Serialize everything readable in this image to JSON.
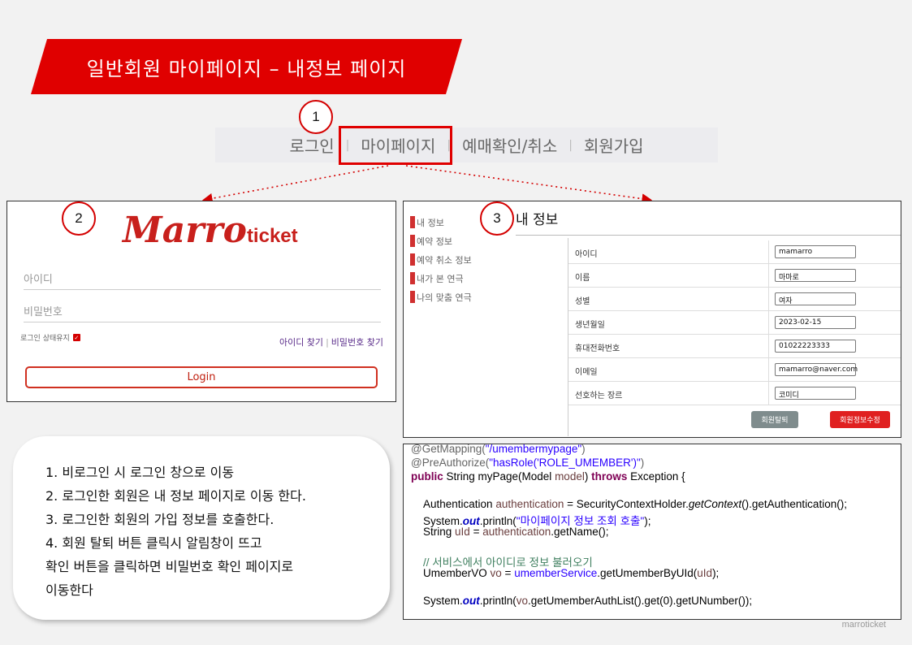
{
  "banner": {
    "title": "일반회원 마이페이지 – 내정보 페이지"
  },
  "steps": [
    "1",
    "2",
    "3"
  ],
  "nav": {
    "items": [
      "로그인",
      "마이페이지",
      "예매확인/취소",
      "회원가입"
    ]
  },
  "login": {
    "logo_main": "Marro",
    "logo_sub": "ticket",
    "id_placeholder": "아이디",
    "pw_placeholder": "비밀번호",
    "remember_label": "로그인 상태유지",
    "find_id": "아이디 찾기",
    "find_pw": "비밀번호 찾기",
    "login_button": "Login"
  },
  "mypage": {
    "title": "내 정보",
    "menu": [
      "내 정보",
      "예약 정보",
      "예약 취소 정보",
      "내가 본 연극",
      "나의 맞춤 연극"
    ],
    "fields": [
      {
        "label": "아이디",
        "value": "mamarro"
      },
      {
        "label": "이름",
        "value": "마마로"
      },
      {
        "label": "성별",
        "value": "여자"
      },
      {
        "label": "생년월일",
        "value": "2023-02-15"
      },
      {
        "label": "휴대전화번호",
        "value": "01022223333"
      },
      {
        "label": "이메일",
        "value": "mamarro@naver.com"
      },
      {
        "label": "선호하는 장르",
        "value": "코미디"
      }
    ],
    "withdraw_button": "회원탈퇴",
    "edit_button": "회원정보수정"
  },
  "notes": [
    "1. 비로그인 시 로그인 창으로 이동",
    "2. 로그인한 회원은 내 정보 페이지로 이동 한다.",
    "3. 로그인한 회원의 가입 정보를 호출한다.",
    "4. 회원 탈퇴 버튼 클릭시 알림창이 뜨고",
    "확인 버튼을 클릭하면 비밀번호 확인 페이지로",
    "이동한다"
  ],
  "code": {
    "l1_ann": "@GetMapping(",
    "l1_str": "\"/umembermypage\"",
    "l1_end": ")",
    "l2_ann": "@PreAuthorize(",
    "l2_str": "\"hasRole('ROLE_UMEMBER')\"",
    "l2_end": ")",
    "l3_kw1": "public",
    "l3_a": " String myPage(Model ",
    "l3_var": "model",
    "l3_b": ") ",
    "l3_kw2": "throws",
    "l3_c": " Exception {",
    "l4_a": "Authentication ",
    "l4_var": "authentication",
    "l4_b": " = SecurityContextHolder.",
    "l4_it": "getContext",
    "l4_c": "().getAuthentication();",
    "l5_a": "System.",
    "l5_fld": "out",
    "l5_b": ".println(",
    "l5_str": "\"마이페이지 정보 조회 호출\"",
    "l5_c": ");",
    "l6_a": "String ",
    "l6_var": "uId",
    "l6_b": " = ",
    "l6_var2": "authentication",
    "l6_c": ".getName();",
    "l7_cmt": "// 서비스에서 아이디로 정보 불러오기",
    "l8_a": "UmemberVO ",
    "l8_var": "vo",
    "l8_b": " = ",
    "l8_fld": "umemberService",
    "l8_c": ".getUmemberByUId(",
    "l8_var2": "uId",
    "l8_d": ");",
    "l9_a": "System.",
    "l9_fld": "out",
    "l9_b": ".println(",
    "l9_var": "vo",
    "l9_c": ".getUmemberAuthList().get(0).getUNumber());"
  },
  "watermark": "marroticket"
}
